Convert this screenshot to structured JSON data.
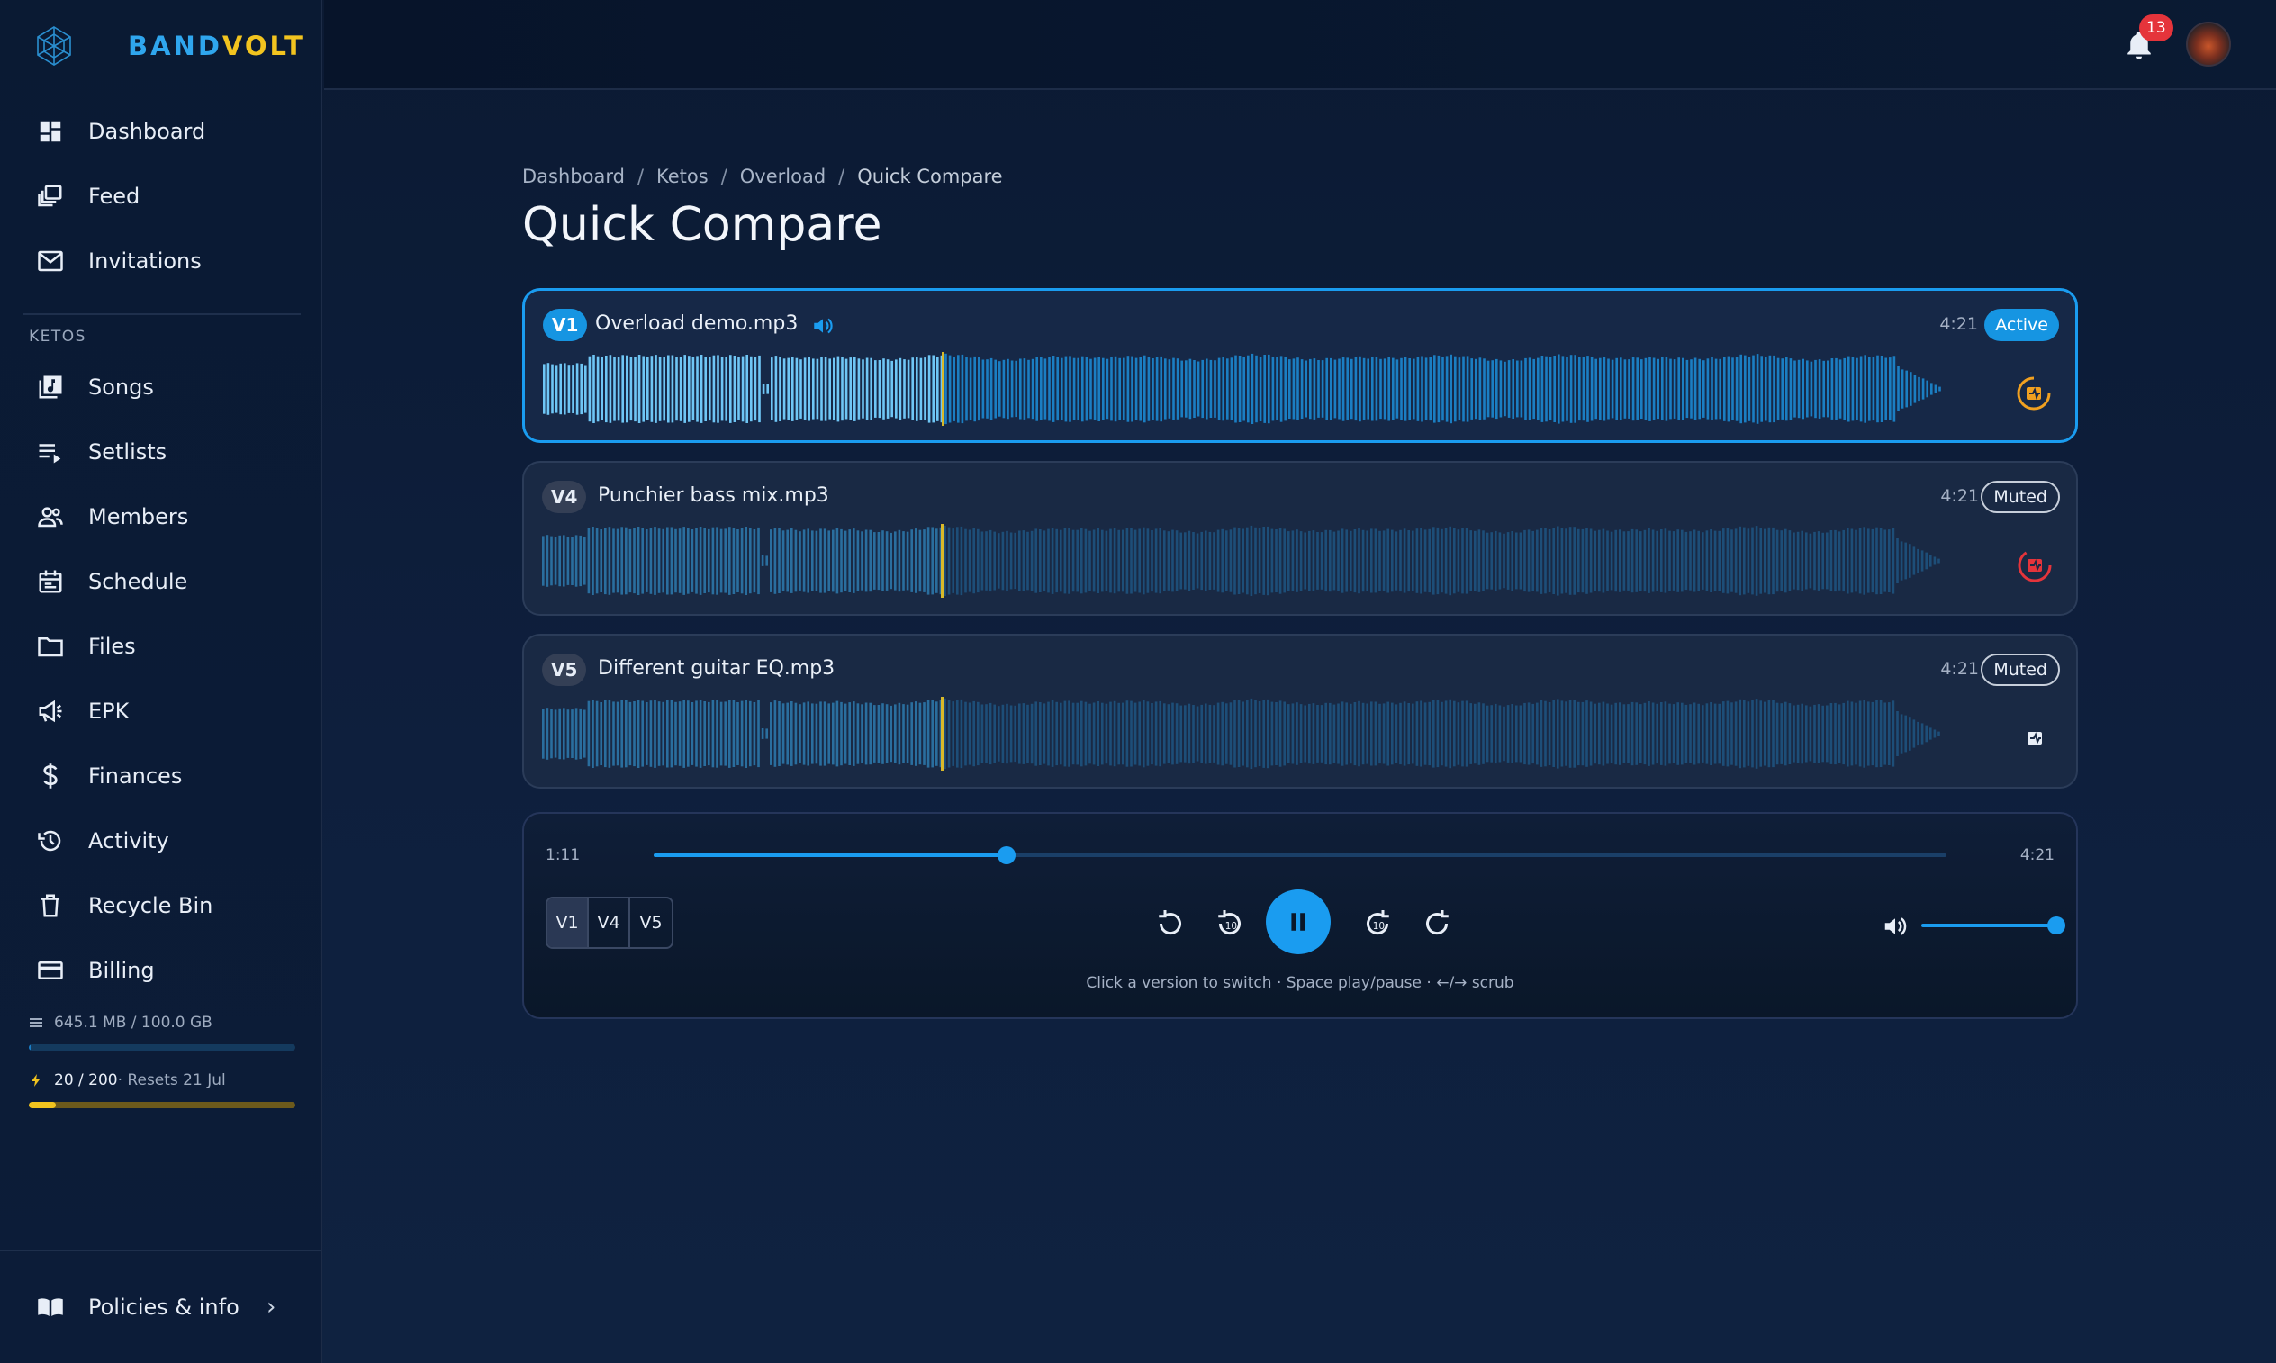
{
  "brand": {
    "part1": "BAND",
    "part2": "VOLT"
  },
  "nav": {
    "dashboard": "Dashboard",
    "feed": "Feed",
    "invitations": "Invitations",
    "section": "KETOS",
    "songs": "Songs",
    "setlists": "Setlists",
    "members": "Members",
    "schedule": "Schedule",
    "files": "Files",
    "epk": "EPK",
    "finances": "Finances",
    "activity": "Activity",
    "recycle_bin": "Recycle Bin",
    "billing": "Billing",
    "policies": "Policies & info"
  },
  "storage": {
    "text": "645.1 MB / 100.0 GB",
    "fraction": 0.0065
  },
  "credits": {
    "value": "20 / 200",
    "reset": " · Resets 21 Jul",
    "fraction": 0.1
  },
  "header": {
    "notifications": "13"
  },
  "breadcrumb": [
    "Dashboard",
    "Ketos",
    "Overload",
    "Quick Compare"
  ],
  "page_title": "Quick Compare",
  "versions": [
    {
      "tag": "V1",
      "file": "Overload demo.mp3",
      "duration": "4:21",
      "status": "Active"
    },
    {
      "tag": "V4",
      "file": "Punchier bass mix.mp3",
      "duration": "4:21",
      "status": "Muted"
    },
    {
      "tag": "V5",
      "file": "Different guitar EQ.mp3",
      "duration": "4:21",
      "status": "Muted"
    }
  ],
  "player": {
    "current": "1:11",
    "total": "4:21",
    "progress": 0.273,
    "volume": 1.0,
    "switch": [
      "V1",
      "V4",
      "V5"
    ],
    "hint": "Click a version to switch · Space play/pause · ←/→ scrub"
  },
  "colors": {
    "accent": "#1a9cf0",
    "brand_yellow": "#f2c41f",
    "danger": "#e5343b",
    "orange": "#f0a020"
  }
}
